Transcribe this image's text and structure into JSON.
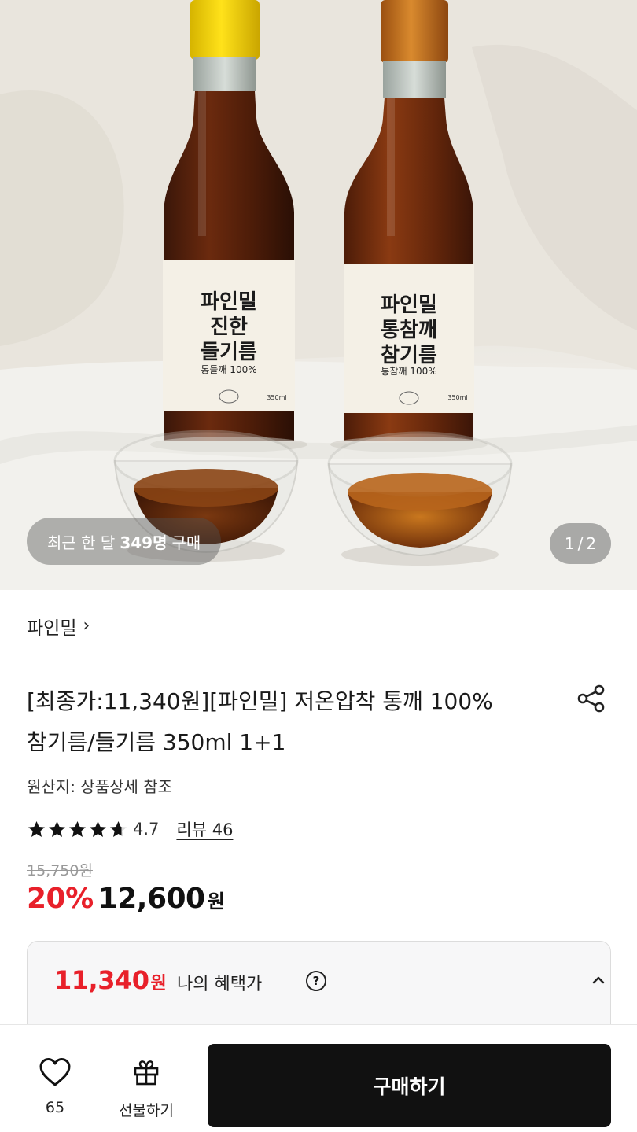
{
  "hero": {
    "image_alt": "파인밀 들기름 참기름 두 병과 유리 그릇",
    "bottle_left": {
      "lines": [
        "파인밀",
        "진한",
        "들기름"
      ],
      "sub": "통들깨 100%",
      "volume": "350ml"
    },
    "bottle_right": {
      "lines": [
        "파인밀",
        "통참깨",
        "참기름"
      ],
      "sub": "통참깨 100%",
      "volume": "350ml"
    },
    "recent_prefix": "최근 한 달",
    "recent_count": "349명",
    "recent_suffix": "구매",
    "page_current": "1",
    "page_sep": "/",
    "page_total": "2"
  },
  "store": {
    "name": "파인밀",
    "chevron": "›"
  },
  "product": {
    "title_line1": "[최종가:11,340원][파인밀] 저온압착 통깨 100%",
    "title_line2": "참기름/들기름 350ml 1+1",
    "origin": "원산지: 상품상세 참조",
    "rating": "4.7",
    "stars_filled": 4.7,
    "review_label": "리뷰 46",
    "original_price": "15,750원",
    "discount_rate": "20%",
    "sale_price": "12,600",
    "won": "원"
  },
  "benefit": {
    "price": "11,340",
    "won": "원",
    "label": "나의 혜택가",
    "help": "?"
  },
  "bottom_bar": {
    "like_count": "65",
    "gift_label": "선물하기",
    "buy_label": "구매하기"
  },
  "colors": {
    "accent_red": "#e8202a",
    "buy_button_bg": "#111111"
  }
}
